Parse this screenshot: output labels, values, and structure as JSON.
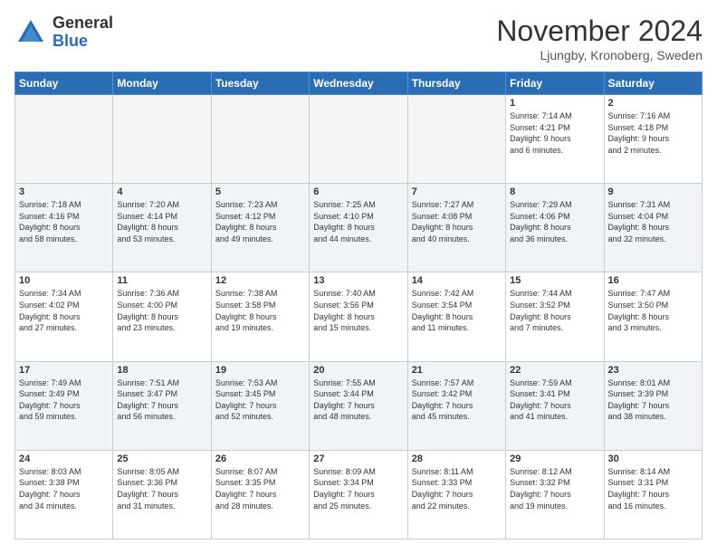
{
  "logo": {
    "general": "General",
    "blue": "Blue"
  },
  "title": "November 2024",
  "location": "Ljungby, Kronoberg, Sweden",
  "weekdays": [
    "Sunday",
    "Monday",
    "Tuesday",
    "Wednesday",
    "Thursday",
    "Friday",
    "Saturday"
  ],
  "weeks": [
    [
      {
        "day": "",
        "info": ""
      },
      {
        "day": "",
        "info": ""
      },
      {
        "day": "",
        "info": ""
      },
      {
        "day": "",
        "info": ""
      },
      {
        "day": "",
        "info": ""
      },
      {
        "day": "1",
        "info": "Sunrise: 7:14 AM\nSunset: 4:21 PM\nDaylight: 9 hours\nand 6 minutes."
      },
      {
        "day": "2",
        "info": "Sunrise: 7:16 AM\nSunset: 4:18 PM\nDaylight: 9 hours\nand 2 minutes."
      }
    ],
    [
      {
        "day": "3",
        "info": "Sunrise: 7:18 AM\nSunset: 4:16 PM\nDaylight: 8 hours\nand 58 minutes."
      },
      {
        "day": "4",
        "info": "Sunrise: 7:20 AM\nSunset: 4:14 PM\nDaylight: 8 hours\nand 53 minutes."
      },
      {
        "day": "5",
        "info": "Sunrise: 7:23 AM\nSunset: 4:12 PM\nDaylight: 8 hours\nand 49 minutes."
      },
      {
        "day": "6",
        "info": "Sunrise: 7:25 AM\nSunset: 4:10 PM\nDaylight: 8 hours\nand 44 minutes."
      },
      {
        "day": "7",
        "info": "Sunrise: 7:27 AM\nSunset: 4:08 PM\nDaylight: 8 hours\nand 40 minutes."
      },
      {
        "day": "8",
        "info": "Sunrise: 7:29 AM\nSunset: 4:06 PM\nDaylight: 8 hours\nand 36 minutes."
      },
      {
        "day": "9",
        "info": "Sunrise: 7:31 AM\nSunset: 4:04 PM\nDaylight: 8 hours\nand 32 minutes."
      }
    ],
    [
      {
        "day": "10",
        "info": "Sunrise: 7:34 AM\nSunset: 4:02 PM\nDaylight: 8 hours\nand 27 minutes."
      },
      {
        "day": "11",
        "info": "Sunrise: 7:36 AM\nSunset: 4:00 PM\nDaylight: 8 hours\nand 23 minutes."
      },
      {
        "day": "12",
        "info": "Sunrise: 7:38 AM\nSunset: 3:58 PM\nDaylight: 8 hours\nand 19 minutes."
      },
      {
        "day": "13",
        "info": "Sunrise: 7:40 AM\nSunset: 3:56 PM\nDaylight: 8 hours\nand 15 minutes."
      },
      {
        "day": "14",
        "info": "Sunrise: 7:42 AM\nSunset: 3:54 PM\nDaylight: 8 hours\nand 11 minutes."
      },
      {
        "day": "15",
        "info": "Sunrise: 7:44 AM\nSunset: 3:52 PM\nDaylight: 8 hours\nand 7 minutes."
      },
      {
        "day": "16",
        "info": "Sunrise: 7:47 AM\nSunset: 3:50 PM\nDaylight: 8 hours\nand 3 minutes."
      }
    ],
    [
      {
        "day": "17",
        "info": "Sunrise: 7:49 AM\nSunset: 3:49 PM\nDaylight: 7 hours\nand 59 minutes."
      },
      {
        "day": "18",
        "info": "Sunrise: 7:51 AM\nSunset: 3:47 PM\nDaylight: 7 hours\nand 56 minutes."
      },
      {
        "day": "19",
        "info": "Sunrise: 7:53 AM\nSunset: 3:45 PM\nDaylight: 7 hours\nand 52 minutes."
      },
      {
        "day": "20",
        "info": "Sunrise: 7:55 AM\nSunset: 3:44 PM\nDaylight: 7 hours\nand 48 minutes."
      },
      {
        "day": "21",
        "info": "Sunrise: 7:57 AM\nSunset: 3:42 PM\nDaylight: 7 hours\nand 45 minutes."
      },
      {
        "day": "22",
        "info": "Sunrise: 7:59 AM\nSunset: 3:41 PM\nDaylight: 7 hours\nand 41 minutes."
      },
      {
        "day": "23",
        "info": "Sunrise: 8:01 AM\nSunset: 3:39 PM\nDaylight: 7 hours\nand 38 minutes."
      }
    ],
    [
      {
        "day": "24",
        "info": "Sunrise: 8:03 AM\nSunset: 3:38 PM\nDaylight: 7 hours\nand 34 minutes."
      },
      {
        "day": "25",
        "info": "Sunrise: 8:05 AM\nSunset: 3:36 PM\nDaylight: 7 hours\nand 31 minutes."
      },
      {
        "day": "26",
        "info": "Sunrise: 8:07 AM\nSunset: 3:35 PM\nDaylight: 7 hours\nand 28 minutes."
      },
      {
        "day": "27",
        "info": "Sunrise: 8:09 AM\nSunset: 3:34 PM\nDaylight: 7 hours\nand 25 minutes."
      },
      {
        "day": "28",
        "info": "Sunrise: 8:11 AM\nSunset: 3:33 PM\nDaylight: 7 hours\nand 22 minutes."
      },
      {
        "day": "29",
        "info": "Sunrise: 8:12 AM\nSunset: 3:32 PM\nDaylight: 7 hours\nand 19 minutes."
      },
      {
        "day": "30",
        "info": "Sunrise: 8:14 AM\nSunset: 3:31 PM\nDaylight: 7 hours\nand 16 minutes."
      }
    ]
  ]
}
